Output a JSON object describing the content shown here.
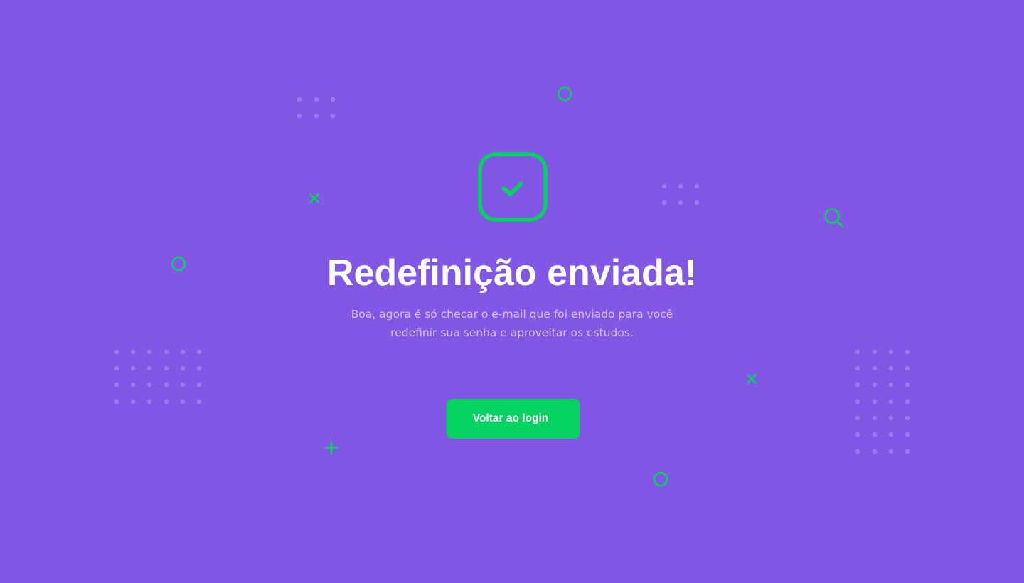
{
  "colors": {
    "background": "#8257E5",
    "accent": "#04D361",
    "title": "#FFFFFF",
    "description": "#D4C2FF",
    "dot_pattern": "#9B7AEC"
  },
  "success_icon": {
    "name": "check-square-icon"
  },
  "title": "Redefinição enviada!",
  "description": {
    "line1": "Boa, agora é só checar o e-mail que foi enviado para você",
    "line2": "redefinir sua senha e aproveitar os estudos."
  },
  "back_button": {
    "label": "Voltar ao login"
  }
}
